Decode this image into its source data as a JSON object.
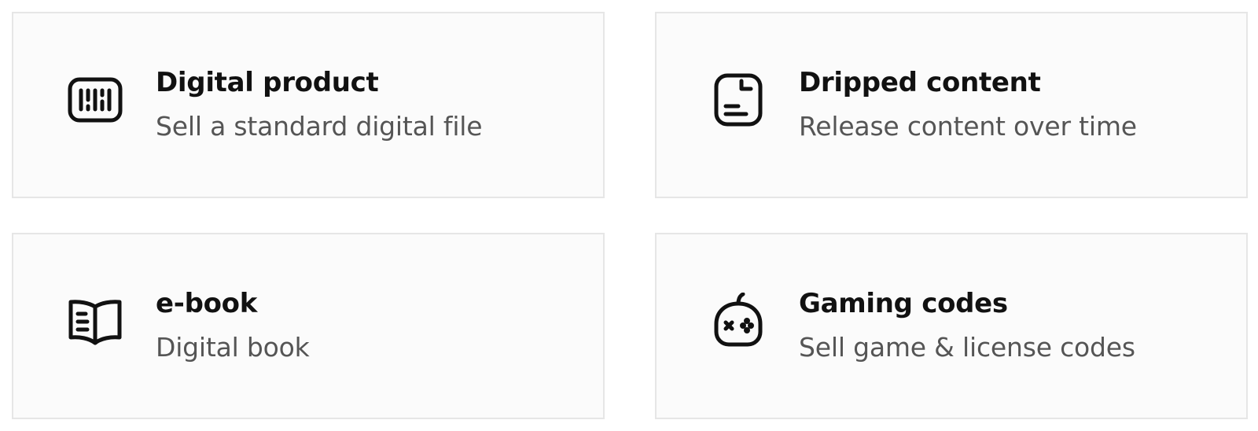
{
  "cards": [
    {
      "icon": "barcode-icon",
      "title": "Digital product",
      "description": "Sell a standard digital file"
    },
    {
      "icon": "document-icon",
      "title": "Dripped content",
      "description": "Release content over time"
    },
    {
      "icon": "book-icon",
      "title": "e-book",
      "description": "Digital book"
    },
    {
      "icon": "gamepad-icon",
      "title": "Gaming codes",
      "description": "Sell game & license codes"
    }
  ],
  "colors": {
    "card_background": "#fbfbfb",
    "card_border": "#e6e6e6",
    "title": "#111111",
    "description": "#555555",
    "icon": "#111111"
  }
}
